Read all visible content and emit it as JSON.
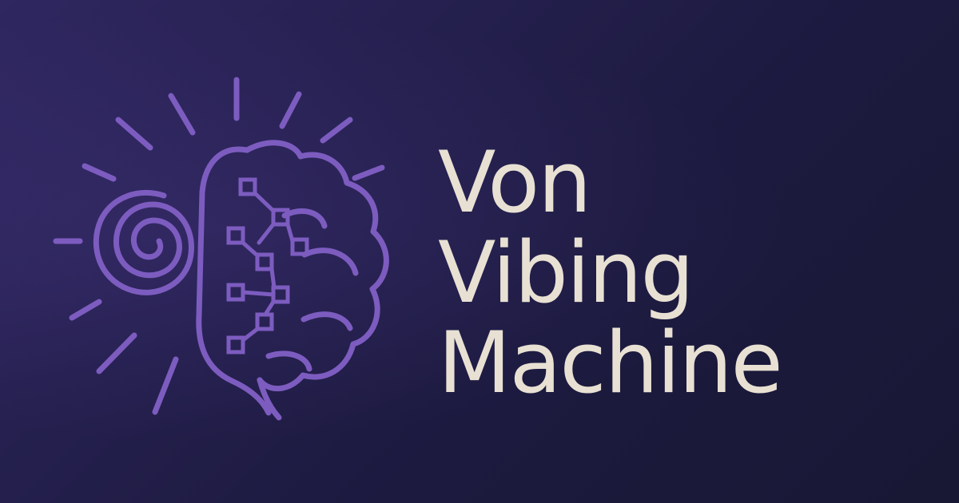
{
  "brand": {
    "title_lines": [
      "Von",
      "Vibing",
      "Machine"
    ],
    "logo_icon": "brain-circuit-spiral-icon",
    "colors": {
      "background_top": "#2f2760",
      "background_bottom": "#181834",
      "accent": "#7d5cc0",
      "title_text": "#e8e1d3"
    }
  }
}
